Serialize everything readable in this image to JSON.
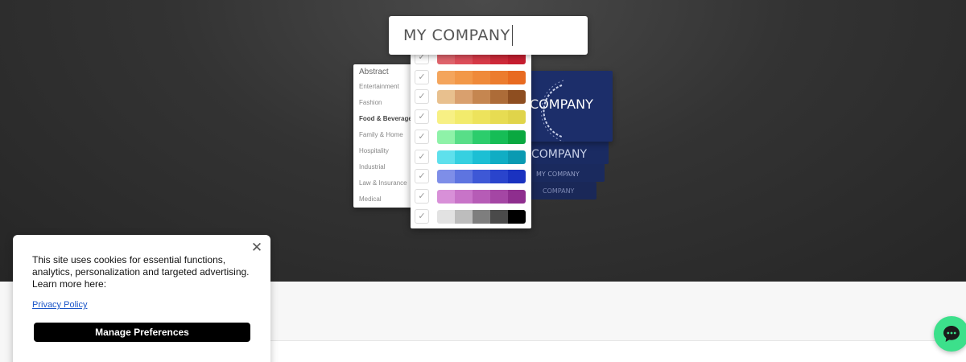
{
  "name_input": {
    "value": "MY COMPANY"
  },
  "category_panel": {
    "title": "Abstract",
    "items": [
      {
        "label": "Entertainment",
        "selected": false
      },
      {
        "label": "Fashion",
        "selected": false
      },
      {
        "label": "Food & Beverage",
        "selected": true
      },
      {
        "label": "Family & Home",
        "selected": false
      },
      {
        "label": "Hospitality",
        "selected": false
      },
      {
        "label": "Industrial",
        "selected": false
      },
      {
        "label": "Law & Insurance",
        "selected": false
      },
      {
        "label": "Medical",
        "selected": false
      }
    ]
  },
  "color_panel": {
    "check_glyph": "✓",
    "palettes": [
      {
        "name": "red",
        "colors": [
          "#e0646c",
          "#de4e5a",
          "#d83a48",
          "#cf2a3a",
          "#c71e30"
        ]
      },
      {
        "name": "orange",
        "colors": [
          "#f4a55c",
          "#f29848",
          "#ef8a3a",
          "#ec7c2e",
          "#e86a20"
        ]
      },
      {
        "name": "brown",
        "colors": [
          "#e8c08e",
          "#d9a06e",
          "#c58650",
          "#ad6c38",
          "#8e4e20"
        ]
      },
      {
        "name": "yellow",
        "colors": [
          "#f7f084",
          "#f2eb6c",
          "#ede35c",
          "#e7dc52",
          "#e0d44a"
        ]
      },
      {
        "name": "green",
        "colors": [
          "#8ef2a8",
          "#58de88",
          "#2ccd6c",
          "#16bd56",
          "#0aa840"
        ]
      },
      {
        "name": "teal",
        "colors": [
          "#5ee0ec",
          "#36d0e0",
          "#1cbfd4",
          "#10adc4",
          "#0a9ab2"
        ]
      },
      {
        "name": "blue",
        "colors": [
          "#7e8ee8",
          "#5e74e0",
          "#3e58d6",
          "#2a44cc",
          "#1a32c0"
        ]
      },
      {
        "name": "purple",
        "colors": [
          "#d890d8",
          "#c874c8",
          "#b65cb6",
          "#a446a4",
          "#8e2e8e"
        ]
      },
      {
        "name": "gray",
        "colors": [
          "#e2e2e2",
          "#bdbdbd",
          "#7e7e7e",
          "#4a4a4a",
          "#000000"
        ]
      }
    ]
  },
  "logo_preview": {
    "text_large": "COMPANY",
    "text_medium": "COMPANY",
    "text_small": "MY COMPANY",
    "text_tiny": "COMPANY",
    "background": "#1c2e6a"
  },
  "cookie_banner": {
    "message": "This site uses cookies for essential functions, analytics, personalization and targeted advertising. Learn more here:",
    "privacy_link": "Privacy Policy",
    "manage_button": "Manage Preferences",
    "close_glyph": "✕"
  },
  "chat": {
    "icon": "chat-bubble-icon",
    "color": "#3ce08b"
  }
}
